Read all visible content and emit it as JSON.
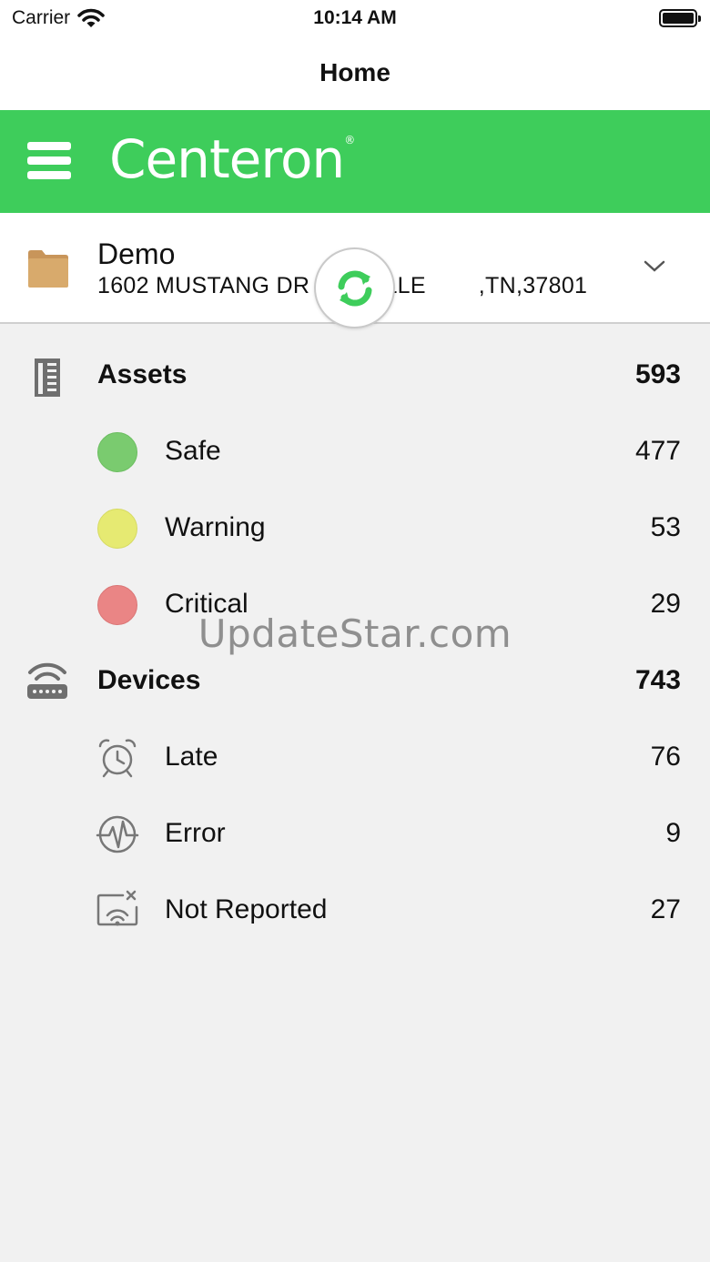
{
  "status_bar": {
    "carrier": "Carrier",
    "time": "10:14 AM",
    "wifi_icon": "wifi-icon",
    "battery_icon": "battery-icon"
  },
  "nav": {
    "title": "Home"
  },
  "brand": {
    "logo_text": "Centeron",
    "registered_mark": "®",
    "background_color": "#3ecd5b",
    "menu_icon": "hamburger-menu-icon"
  },
  "site": {
    "name": "Demo",
    "address": "1602 MUSTANG DR        VILLE        ,TN,37801",
    "folder_icon": "folder-icon",
    "folder_color": "#d4a76a",
    "dropdown_icon": "chevron-down-icon"
  },
  "refresh": {
    "icon": "sync-icon",
    "color": "#3ecd5b"
  },
  "assets": {
    "label": "Assets",
    "count": "593",
    "icon": "building-icon",
    "items": [
      {
        "label": "Safe",
        "count": "477",
        "color": "#7acb6f"
      },
      {
        "label": "Warning",
        "count": "53",
        "color": "#e6ea72"
      },
      {
        "label": "Critical",
        "count": "29",
        "color": "#ea8585"
      }
    ]
  },
  "devices": {
    "label": "Devices",
    "count": "743",
    "icon": "router-icon",
    "items": [
      {
        "label": "Late",
        "count": "76",
        "icon": "alarm-clock-icon"
      },
      {
        "label": "Error",
        "count": "9",
        "icon": "pulse-icon"
      },
      {
        "label": "Not Reported",
        "count": "27",
        "icon": "no-signal-icon"
      }
    ]
  },
  "watermark": "UpdateStar.com"
}
